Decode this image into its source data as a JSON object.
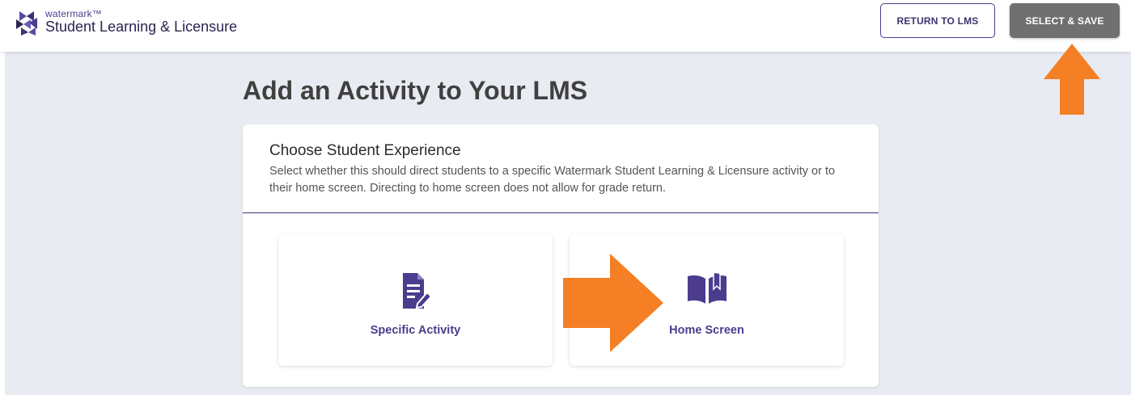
{
  "header": {
    "brand_small": "watermark™",
    "brand_main": "Student Learning & Licensure",
    "return_label": "RETURN TO LMS",
    "save_label": "SELECT & SAVE"
  },
  "page": {
    "title": "Add an Activity to Your LMS"
  },
  "card": {
    "heading": "Choose Student Experience",
    "description": "Select whether this should direct students to a specific Watermark Student Learning & Licensure activity or to their home screen. Directing to home screen does not allow for grade return.",
    "options": [
      {
        "label": "Specific Activity",
        "icon": "document-edit-icon"
      },
      {
        "label": "Home Screen",
        "icon": "open-book-icon"
      }
    ]
  },
  "colors": {
    "brand_purple": "#4b3c8e",
    "save_button": "#707070",
    "annotation_arrow": "#f47f24",
    "page_background": "#e9ebf2"
  }
}
